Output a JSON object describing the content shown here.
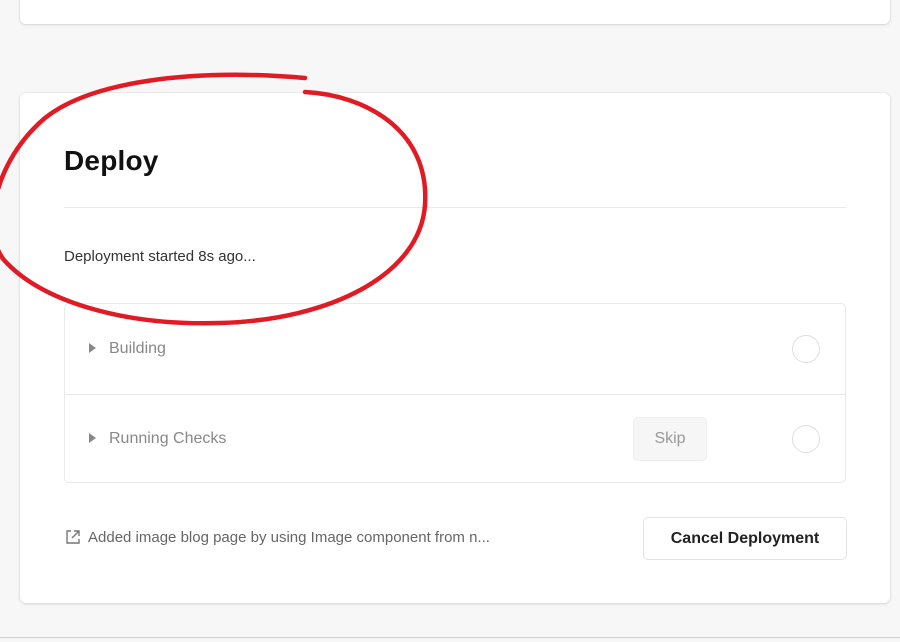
{
  "deploy": {
    "title": "Deploy",
    "status": "Deployment started 8s ago...",
    "steps": [
      {
        "label": "Building",
        "icon": "caret-right-icon",
        "state": "pending"
      },
      {
        "label": "Running Checks",
        "icon": "caret-right-icon",
        "state": "pending",
        "action_label": "Skip"
      }
    ],
    "commit_message": "Added image blog page by using Image component from n...",
    "commit_icon": "external-link-icon",
    "cancel_label": "Cancel Deployment"
  },
  "colors": {
    "annotation": "#e01b24",
    "card_background": "#ffffff",
    "page_background": "#f7f7f7",
    "muted_text": "#888888"
  }
}
